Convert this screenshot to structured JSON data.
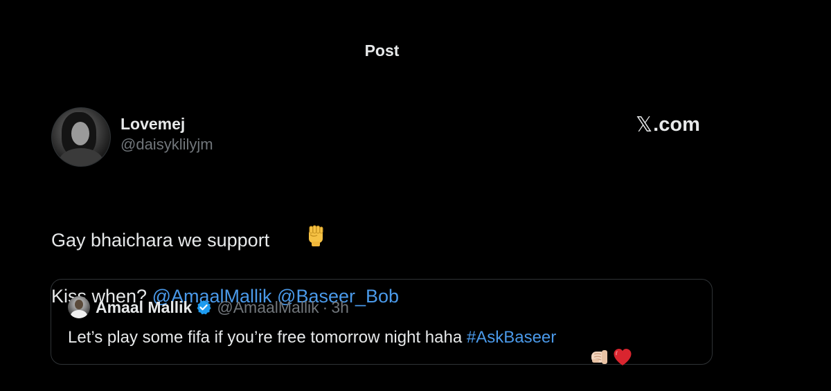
{
  "header": {
    "title": "Post"
  },
  "post": {
    "author": {
      "display_name": "Lovemej",
      "handle": "@daisyklilyjm"
    },
    "brand": {
      "logo_glyph": "𝕏",
      "label": ".com"
    },
    "text_line1": "Gay bhaichara we support",
    "text_line1_emoji": "raised-fist-emoji",
    "text_line2_prefix": "Kiss when? ",
    "mentions": [
      "@AmaalMallik",
      "@Baseer_Bob"
    ]
  },
  "quote": {
    "display_name": "Amaal Mallik",
    "handle": "@AmaalMallik",
    "separator": "·",
    "time": "3h",
    "text": "Let’s play some fifa if you’re free tomorrow night haha ",
    "hashtag": "#AskBaseer",
    "emojis": [
      "fist-bump-emoji",
      "red-heart-emoji"
    ]
  },
  "colors": {
    "background": "#000000",
    "text_primary": "#e7e9ea",
    "text_secondary": "#71767b",
    "link": "#4a99e9",
    "border": "#2f3336",
    "verified": "#1d9bf0"
  }
}
